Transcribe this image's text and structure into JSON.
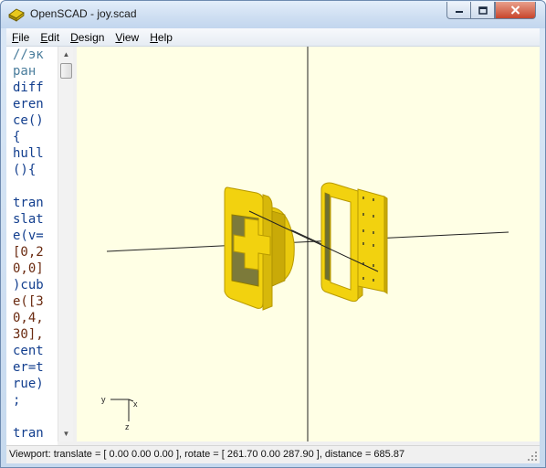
{
  "window": {
    "title": "OpenSCAD - joy.scad",
    "app_icon": "openscad-logo-icon",
    "controls": {
      "minimize_icon": "minimize-icon",
      "maximize_icon": "maximize-icon",
      "close_icon": "close-icon"
    }
  },
  "menu": {
    "items": [
      {
        "label": "File",
        "mnemonic": "F",
        "rest": "ile"
      },
      {
        "label": "Edit",
        "mnemonic": "E",
        "rest": "dit"
      },
      {
        "label": "Design",
        "mnemonic": "D",
        "rest": "esign"
      },
      {
        "label": "View",
        "mnemonic": "V",
        "rest": "iew"
      },
      {
        "label": "Help",
        "mnemonic": "H",
        "rest": "elp"
      }
    ]
  },
  "editor": {
    "lines": [
      {
        "text": "//эк",
        "kind": "c"
      },
      {
        "text": "ран",
        "kind": "c"
      },
      {
        "text": "diff",
        "kind": "k"
      },
      {
        "text": "eren",
        "kind": "k"
      },
      {
        "text": "ce()",
        "kind": "k"
      },
      {
        "text": "{",
        "kind": "k"
      },
      {
        "text": "hull",
        "kind": "k"
      },
      {
        "text": "(){",
        "kind": "k"
      },
      {
        "text": "",
        "kind": "k"
      },
      {
        "text": "tran",
        "kind": "k"
      },
      {
        "text": "slat",
        "kind": "k"
      },
      {
        "text": "e(v=",
        "kind": "k"
      },
      {
        "text": "[0,2",
        "kind": "n"
      },
      {
        "text": "0,0]",
        "kind": "n"
      },
      {
        "text": ")cub",
        "kind": "k"
      },
      {
        "text": "e([3",
        "kind": "n"
      },
      {
        "text": "0,4,",
        "kind": "n"
      },
      {
        "text": "30],",
        "kind": "n"
      },
      {
        "text": "cent",
        "kind": "k"
      },
      {
        "text": "er=t",
        "kind": "k"
      },
      {
        "text": "rue)",
        "kind": "k"
      },
      {
        "text": ";",
        "kind": "k"
      },
      {
        "text": "",
        "kind": "k"
      },
      {
        "text": "tran",
        "kind": "k"
      }
    ],
    "scroll_icons": {
      "up": "scroll-up-arrow-icon",
      "down": "scroll-down-arrow-icon"
    }
  },
  "viewport": {
    "background": "#ffffe5",
    "model_color": "#f5d60f",
    "model_edge_color": "#b89a00",
    "axes_icon": "axes-indicator-icon",
    "axis_labels": {
      "x": "x",
      "y": "y",
      "z": "z"
    }
  },
  "status": {
    "text": "Viewport: translate = [ 0.00 0.00 0.00 ], rotate = [ 261.70 0.00 287.90 ], distance = 685.87"
  }
}
